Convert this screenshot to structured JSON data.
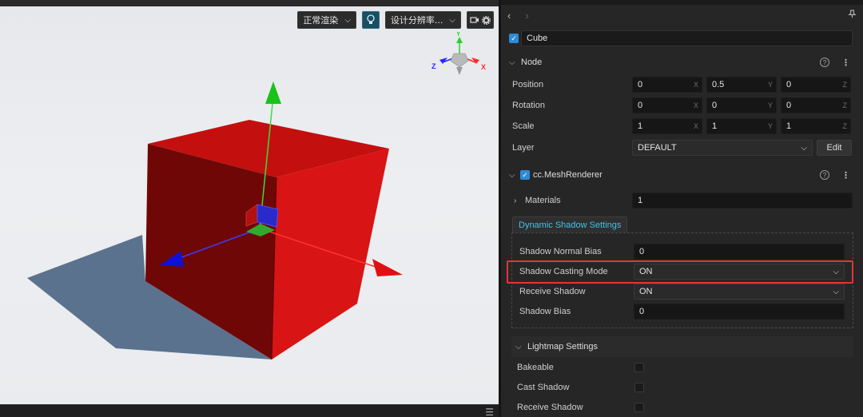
{
  "scene": {
    "render_mode": "正常渲染",
    "resolution": "设计分辨率...",
    "axes": {
      "x": "X",
      "y": "Y",
      "z": "Z"
    }
  },
  "inspector": {
    "node_name": "Cube",
    "node_section": {
      "title": "Node",
      "position": {
        "label": "Position",
        "x": "0",
        "y": "0.5",
        "z": "0"
      },
      "rotation": {
        "label": "Rotation",
        "x": "0",
        "y": "0",
        "z": "0"
      },
      "scale": {
        "label": "Scale",
        "x": "1",
        "y": "1",
        "z": "1"
      },
      "layer": {
        "label": "Layer",
        "value": "DEFAULT",
        "edit_label": "Edit"
      },
      "axis_labels": [
        "X",
        "Y",
        "Z"
      ]
    },
    "mesh_renderer": {
      "title": "cc.MeshRenderer",
      "materials": {
        "label": "Materials",
        "count": "1"
      },
      "dynamic_shadow": {
        "tab_label": "Dynamic Shadow Settings",
        "normal_bias": {
          "label": "Shadow Normal Bias",
          "value": "0"
        },
        "casting_mode": {
          "label": "Shadow Casting Mode",
          "value": "ON"
        },
        "receive_shadow": {
          "label": "Receive Shadow",
          "value": "ON"
        },
        "bias": {
          "label": "Shadow Bias",
          "value": "0"
        }
      },
      "lightmap": {
        "title": "Lightmap Settings",
        "bakeable": "Bakeable",
        "cast_shadow": "Cast Shadow",
        "receive_shadow": "Receive Shadow"
      }
    }
  },
  "colors": {
    "accent": "#2f8ad6",
    "highlight": "#e53535",
    "tab_text": "#3ec3ee",
    "cube": "#d01010"
  }
}
